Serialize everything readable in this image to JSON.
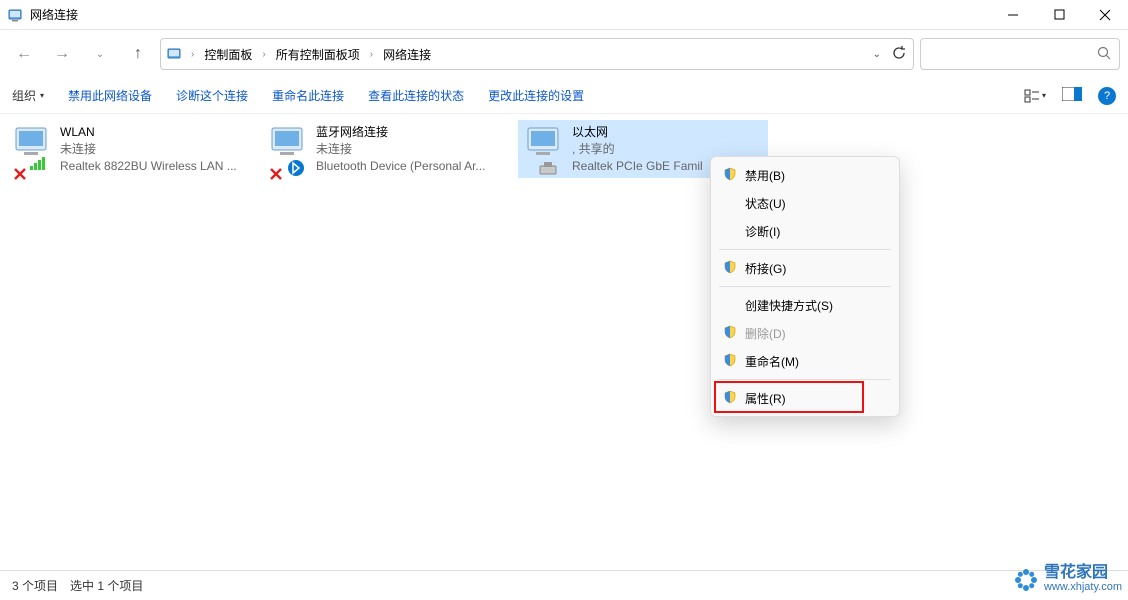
{
  "titlebar": {
    "title": "网络连接"
  },
  "breadcrumb": {
    "items": [
      "控制面板",
      "所有控制面板项",
      "网络连接"
    ]
  },
  "toolbar": {
    "organize": "组织",
    "items": [
      "禁用此网络设备",
      "诊断这个连接",
      "重命名此连接",
      "查看此连接的状态",
      "更改此连接的设置"
    ]
  },
  "connections": [
    {
      "name": "WLAN",
      "status": "未连接",
      "adapter": "Realtek 8822BU Wireless LAN ...",
      "kind": "wifi",
      "disabled_x": true
    },
    {
      "name": "蓝牙网络连接",
      "status": "未连接",
      "adapter": "Bluetooth Device (Personal Ar...",
      "kind": "bt",
      "disabled_x": true
    },
    {
      "name": "以太网",
      "status": ", 共享的",
      "adapter": "Realtek PCIe GbE Famil",
      "kind": "eth",
      "selected": true
    }
  ],
  "context_menu": [
    {
      "label": "禁用(B)",
      "shield": true
    },
    {
      "label": "状态(U)"
    },
    {
      "label": "诊断(I)"
    },
    {
      "sep": true
    },
    {
      "label": "桥接(G)",
      "shield": true
    },
    {
      "sep": true
    },
    {
      "label": "创建快捷方式(S)"
    },
    {
      "label": "删除(D)",
      "shield": true,
      "disabled": true
    },
    {
      "label": "重命名(M)",
      "shield": true
    },
    {
      "sep": true
    },
    {
      "label": "属性(R)",
      "shield": true,
      "highlight": true
    }
  ],
  "statusbar": {
    "count": "3 个项目",
    "selected": "选中 1 个项目"
  },
  "watermark": {
    "name": "雪花家园",
    "url": "www.xhjaty.com"
  }
}
